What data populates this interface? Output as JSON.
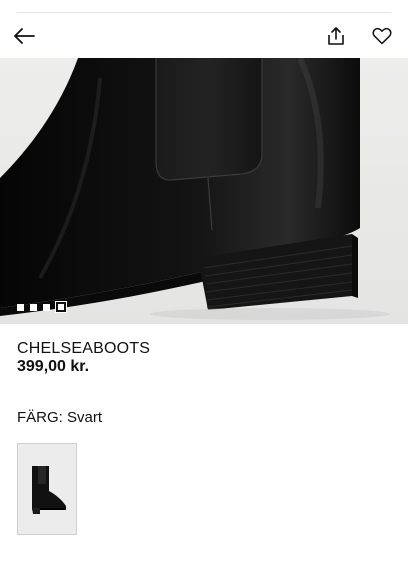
{
  "product": {
    "name": "CHELSEABOOTS",
    "price": "399,00 kr."
  },
  "color": {
    "label": "FÄRG: Svart"
  },
  "gallery": {
    "total_images": 4,
    "current_index": 4
  },
  "colors": {
    "accent": "#111111",
    "background": "#ffffff",
    "hero_background": "#e9e9e8"
  },
  "icons": {
    "back": "arrow-left-icon",
    "share": "share-icon",
    "favorite": "heart-icon"
  }
}
